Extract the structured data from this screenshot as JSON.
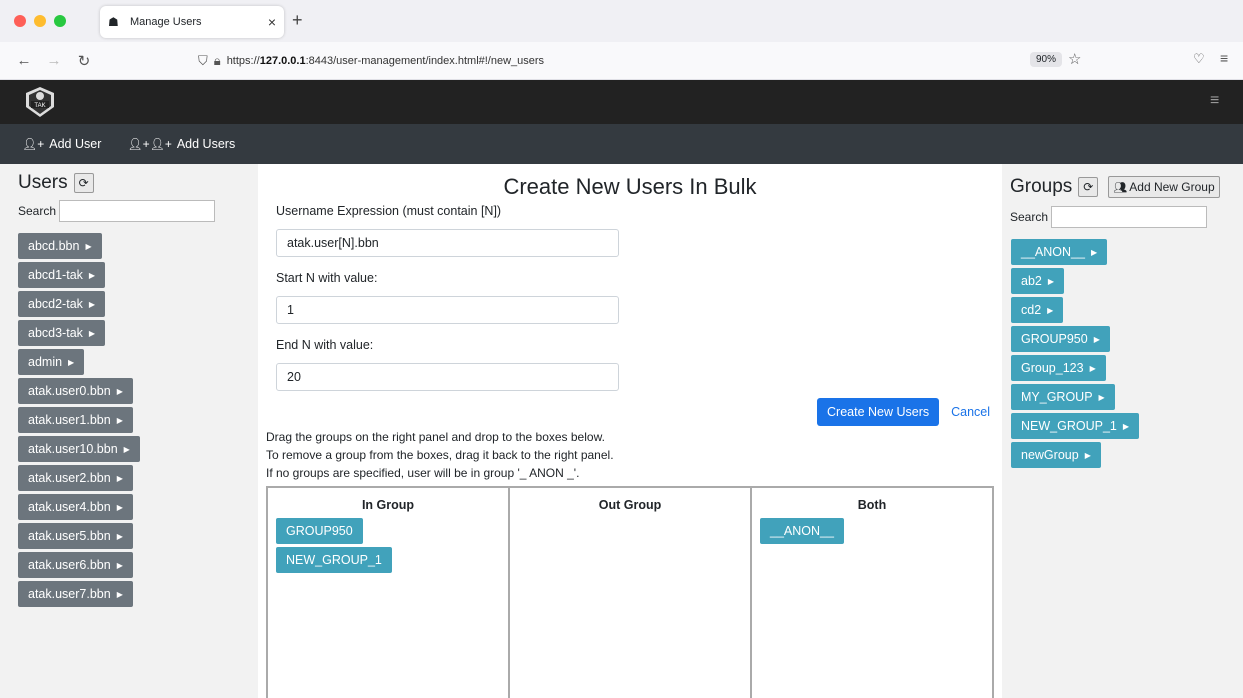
{
  "browser": {
    "tab_title": "Manage Users",
    "tab_close": "×",
    "new_tab": "+",
    "url_prefix": "https://",
    "url_host": "127.0.0.1",
    "url_rest": ":8443/user-management/index.html#!/new_users",
    "zoom": "90%"
  },
  "app": {
    "logo_text": "TAK",
    "nav": [
      {
        "label": "Add User"
      },
      {
        "label": "Add Users"
      }
    ]
  },
  "users_panel": {
    "title": "Users",
    "search_label": "Search",
    "items": [
      "abcd.bbn",
      "abcd1-tak",
      "abcd2-tak",
      "abcd3-tak",
      "admin",
      "atak.user0.bbn",
      "atak.user1.bbn",
      "atak.user10.bbn",
      "atak.user2.bbn",
      "atak.user4.bbn",
      "atak.user5.bbn",
      "atak.user6.bbn",
      "atak.user7.bbn"
    ]
  },
  "form": {
    "title": "Create New Users In Bulk",
    "username_label": "Username Expression (must contain [N])",
    "username_value": "atak.user[N].bbn",
    "start_label": "Start N with value:",
    "start_value": "1",
    "end_label": "End N with value:",
    "end_value": "20",
    "create_button": "Create New Users",
    "cancel_link": "Cancel",
    "instructions": [
      "Drag the groups on the right panel and drop to the boxes below.",
      "To remove a group from the boxes, drag it back to the right panel.",
      "If no groups are specified, user will be in group '_ ANON _'."
    ]
  },
  "boxes": {
    "in_group": {
      "title": "In Group",
      "items": [
        "GROUP950",
        "NEW_GROUP_1"
      ]
    },
    "out_group": {
      "title": "Out Group",
      "items": []
    },
    "both": {
      "title": "Both",
      "items": [
        "__ANON__"
      ]
    }
  },
  "groups_panel": {
    "title": "Groups",
    "add_button": "Add New Group",
    "search_label": "Search",
    "items": [
      "__ANON__",
      "ab2",
      "cd2",
      "GROUP950",
      "Group_123",
      "MY_GROUP",
      "NEW_GROUP_1",
      "newGroup"
    ]
  },
  "colors": {
    "user_chip": "#6c757d",
    "group_chip": "#41a2bb",
    "primary": "#1a73e8",
    "app_header": "#222222",
    "subnav": "#343a40"
  }
}
